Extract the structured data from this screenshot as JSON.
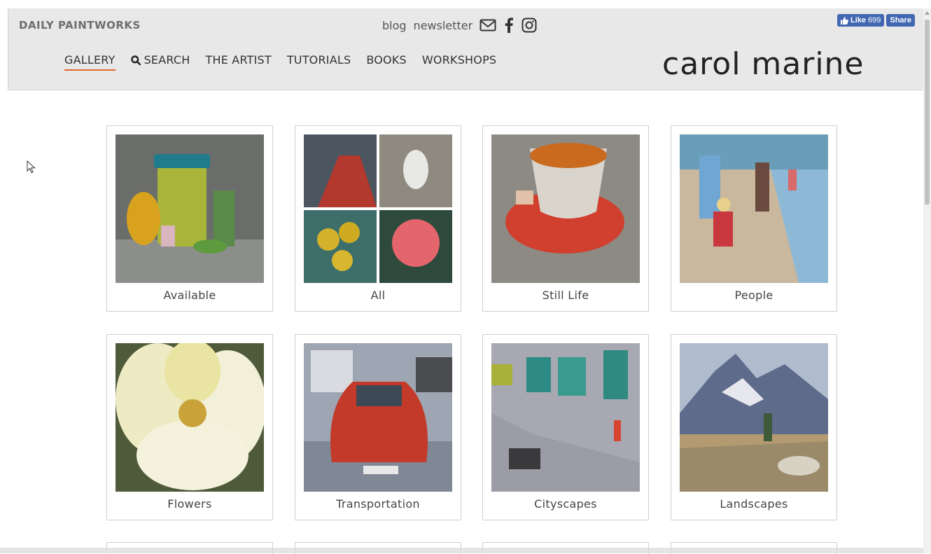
{
  "header": {
    "brand": "DAILY PAINTWORKS",
    "util_links": [
      "blog",
      "newsletter"
    ],
    "util_icons": [
      "envelope-icon",
      "facebook-icon",
      "instagram-icon"
    ],
    "fb_like_label": "Like",
    "fb_like_count": "699",
    "fb_share_label": "Share",
    "nav": [
      {
        "label": "GALLERY",
        "active": true
      },
      {
        "label": "SEARCH",
        "icon": "search-icon"
      },
      {
        "label": "THE ARTIST"
      },
      {
        "label": "TUTORIALS"
      },
      {
        "label": "BOOKS"
      },
      {
        "label": "WORKSHOPS"
      }
    ],
    "logo": "carol marine"
  },
  "gallery": {
    "categories": [
      "Available",
      "All",
      "Still Life",
      "People",
      "Flowers",
      "Transportation",
      "Cityscapes",
      "Landscapes"
    ]
  },
  "colors": {
    "header_bg": "#e8e8e8",
    "active_underline": "#e06a2c",
    "facebook_blue": "#4267b2"
  }
}
